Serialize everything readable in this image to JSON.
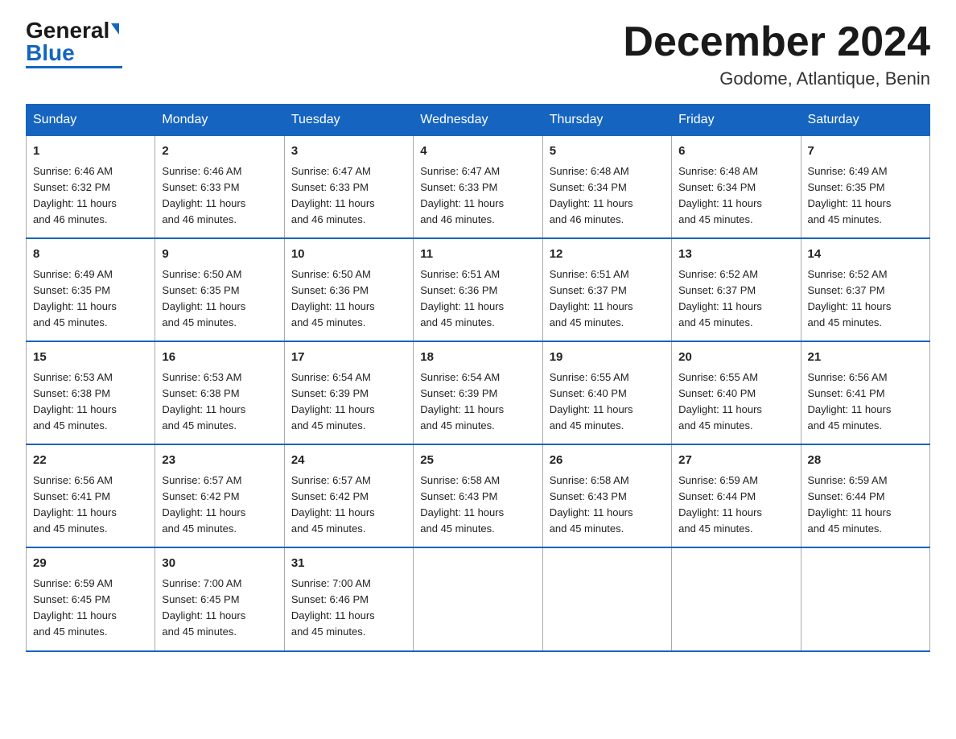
{
  "header": {
    "logo_general": "General",
    "logo_blue": "Blue",
    "month_title": "December 2024",
    "location": "Godome, Atlantique, Benin"
  },
  "days_of_week": [
    "Sunday",
    "Monday",
    "Tuesday",
    "Wednesday",
    "Thursday",
    "Friday",
    "Saturday"
  ],
  "weeks": [
    [
      {
        "day": "1",
        "content": "Sunrise: 6:46 AM\nSunset: 6:32 PM\nDaylight: 11 hours\nand 46 minutes."
      },
      {
        "day": "2",
        "content": "Sunrise: 6:46 AM\nSunset: 6:33 PM\nDaylight: 11 hours\nand 46 minutes."
      },
      {
        "day": "3",
        "content": "Sunrise: 6:47 AM\nSunset: 6:33 PM\nDaylight: 11 hours\nand 46 minutes."
      },
      {
        "day": "4",
        "content": "Sunrise: 6:47 AM\nSunset: 6:33 PM\nDaylight: 11 hours\nand 46 minutes."
      },
      {
        "day": "5",
        "content": "Sunrise: 6:48 AM\nSunset: 6:34 PM\nDaylight: 11 hours\nand 46 minutes."
      },
      {
        "day": "6",
        "content": "Sunrise: 6:48 AM\nSunset: 6:34 PM\nDaylight: 11 hours\nand 45 minutes."
      },
      {
        "day": "7",
        "content": "Sunrise: 6:49 AM\nSunset: 6:35 PM\nDaylight: 11 hours\nand 45 minutes."
      }
    ],
    [
      {
        "day": "8",
        "content": "Sunrise: 6:49 AM\nSunset: 6:35 PM\nDaylight: 11 hours\nand 45 minutes."
      },
      {
        "day": "9",
        "content": "Sunrise: 6:50 AM\nSunset: 6:35 PM\nDaylight: 11 hours\nand 45 minutes."
      },
      {
        "day": "10",
        "content": "Sunrise: 6:50 AM\nSunset: 6:36 PM\nDaylight: 11 hours\nand 45 minutes."
      },
      {
        "day": "11",
        "content": "Sunrise: 6:51 AM\nSunset: 6:36 PM\nDaylight: 11 hours\nand 45 minutes."
      },
      {
        "day": "12",
        "content": "Sunrise: 6:51 AM\nSunset: 6:37 PM\nDaylight: 11 hours\nand 45 minutes."
      },
      {
        "day": "13",
        "content": "Sunrise: 6:52 AM\nSunset: 6:37 PM\nDaylight: 11 hours\nand 45 minutes."
      },
      {
        "day": "14",
        "content": "Sunrise: 6:52 AM\nSunset: 6:37 PM\nDaylight: 11 hours\nand 45 minutes."
      }
    ],
    [
      {
        "day": "15",
        "content": "Sunrise: 6:53 AM\nSunset: 6:38 PM\nDaylight: 11 hours\nand 45 minutes."
      },
      {
        "day": "16",
        "content": "Sunrise: 6:53 AM\nSunset: 6:38 PM\nDaylight: 11 hours\nand 45 minutes."
      },
      {
        "day": "17",
        "content": "Sunrise: 6:54 AM\nSunset: 6:39 PM\nDaylight: 11 hours\nand 45 minutes."
      },
      {
        "day": "18",
        "content": "Sunrise: 6:54 AM\nSunset: 6:39 PM\nDaylight: 11 hours\nand 45 minutes."
      },
      {
        "day": "19",
        "content": "Sunrise: 6:55 AM\nSunset: 6:40 PM\nDaylight: 11 hours\nand 45 minutes."
      },
      {
        "day": "20",
        "content": "Sunrise: 6:55 AM\nSunset: 6:40 PM\nDaylight: 11 hours\nand 45 minutes."
      },
      {
        "day": "21",
        "content": "Sunrise: 6:56 AM\nSunset: 6:41 PM\nDaylight: 11 hours\nand 45 minutes."
      }
    ],
    [
      {
        "day": "22",
        "content": "Sunrise: 6:56 AM\nSunset: 6:41 PM\nDaylight: 11 hours\nand 45 minutes."
      },
      {
        "day": "23",
        "content": "Sunrise: 6:57 AM\nSunset: 6:42 PM\nDaylight: 11 hours\nand 45 minutes."
      },
      {
        "day": "24",
        "content": "Sunrise: 6:57 AM\nSunset: 6:42 PM\nDaylight: 11 hours\nand 45 minutes."
      },
      {
        "day": "25",
        "content": "Sunrise: 6:58 AM\nSunset: 6:43 PM\nDaylight: 11 hours\nand 45 minutes."
      },
      {
        "day": "26",
        "content": "Sunrise: 6:58 AM\nSunset: 6:43 PM\nDaylight: 11 hours\nand 45 minutes."
      },
      {
        "day": "27",
        "content": "Sunrise: 6:59 AM\nSunset: 6:44 PM\nDaylight: 11 hours\nand 45 minutes."
      },
      {
        "day": "28",
        "content": "Sunrise: 6:59 AM\nSunset: 6:44 PM\nDaylight: 11 hours\nand 45 minutes."
      }
    ],
    [
      {
        "day": "29",
        "content": "Sunrise: 6:59 AM\nSunset: 6:45 PM\nDaylight: 11 hours\nand 45 minutes."
      },
      {
        "day": "30",
        "content": "Sunrise: 7:00 AM\nSunset: 6:45 PM\nDaylight: 11 hours\nand 45 minutes."
      },
      {
        "day": "31",
        "content": "Sunrise: 7:00 AM\nSunset: 6:46 PM\nDaylight: 11 hours\nand 45 minutes."
      },
      {
        "day": "",
        "content": ""
      },
      {
        "day": "",
        "content": ""
      },
      {
        "day": "",
        "content": ""
      },
      {
        "day": "",
        "content": ""
      }
    ]
  ]
}
